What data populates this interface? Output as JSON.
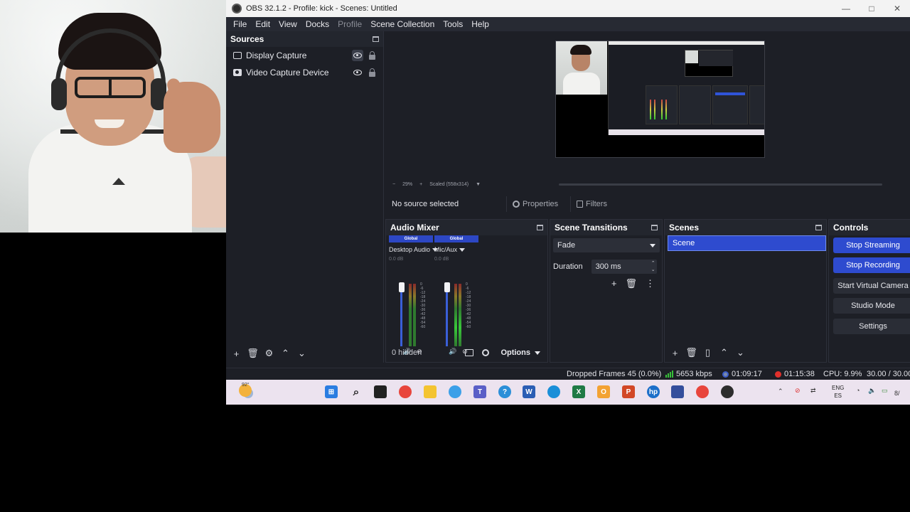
{
  "window": {
    "title": "OBS 32.1.2 - Profile: kick - Scenes: Untitled",
    "controls": [
      "—",
      "□",
      "✕"
    ]
  },
  "menu": [
    "File",
    "Edit",
    "View",
    "Docks",
    "Profile",
    "Scene Collection",
    "Tools",
    "Help"
  ],
  "sources": {
    "title": "Sources",
    "items": [
      {
        "label": "Display Capture",
        "icon": "monitor-icon"
      },
      {
        "label": "Video Capture Device",
        "icon": "camera-icon"
      }
    ]
  },
  "preview": {
    "zoom": "29%",
    "scale_mode": "Scaled (558x314)"
  },
  "source_toolbar": {
    "no_source": "No source selected",
    "properties": "Properties",
    "filters": "Filters"
  },
  "mixer": {
    "title": "Audio Mixer",
    "channels": [
      {
        "badge": "Global",
        "name": "Desktop Audio",
        "db": "0.0 dB"
      },
      {
        "badge": "Global",
        "name": "Mic/Aux",
        "db": "0.0 dB"
      }
    ],
    "scale": [
      "0",
      "-6",
      "-12",
      "-18",
      "-24",
      "-30",
      "-36",
      "-42",
      "-48",
      "-54",
      "-60"
    ],
    "hidden": "0 hidden",
    "options": "Options"
  },
  "transitions": {
    "title": "Scene Transitions",
    "selected": "Fade",
    "duration_label": "Duration",
    "duration_value": "300 ms"
  },
  "scenes": {
    "title": "Scenes",
    "items": [
      "Scene"
    ]
  },
  "controls": {
    "title": "Controls",
    "buttons": [
      {
        "label": "Stop Streaming",
        "active": true
      },
      {
        "label": "Stop Recording",
        "active": true
      },
      {
        "label": "Start Virtual Camera",
        "active": false
      },
      {
        "label": "Studio Mode",
        "active": false
      },
      {
        "label": "Settings",
        "active": false
      }
    ]
  },
  "status": {
    "dropped": "Dropped Frames 45 (0.0%)",
    "bitrate": "5653 kbps",
    "stream_time": "01:09:17",
    "rec_time": "01:15:38",
    "cpu": "CPU: 9.9%",
    "fps": "30.00 / 30.00"
  },
  "taskbar": {
    "temp": "92°",
    "lang_top": "ENG",
    "lang_bottom": "ES",
    "date_fragment": "8/"
  },
  "colors": {
    "accent": "#2e4bcf",
    "bg": "#1d1f26",
    "recording_red": "#e0302b"
  }
}
